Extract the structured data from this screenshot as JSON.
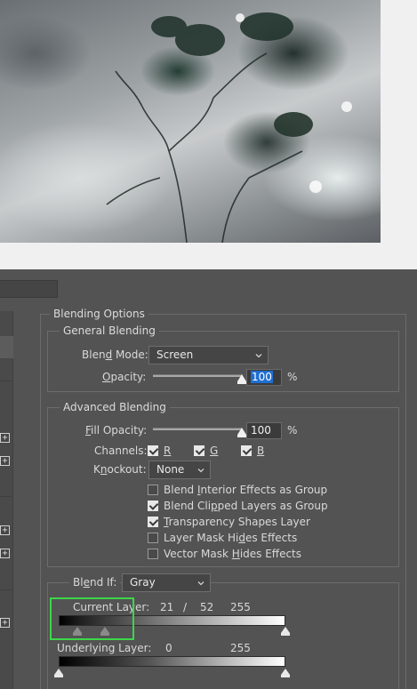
{
  "blending_options": {
    "title": "Blending Options",
    "general": {
      "title": "General Blending",
      "blend_mode_label_pre": "Blen",
      "blend_mode_label_u": "d",
      "blend_mode_label_post": " Mode:",
      "blend_mode_value": "Screen",
      "opacity_label_u": "O",
      "opacity_label_post": "pacity:",
      "opacity_value": "100",
      "opacity_percent": 100,
      "opacity_unit": "%"
    },
    "advanced": {
      "title": "Advanced Blending",
      "fill_opacity_label_u": "F",
      "fill_opacity_label_post": "ill Opacity:",
      "fill_opacity_value": "100",
      "fill_opacity_percent": 100,
      "fill_opacity_unit": "%",
      "channels_label": "Channels:",
      "channel_r": "R",
      "channel_g": "G",
      "channel_b": "B",
      "knockout_label_pre": "K",
      "knockout_label_u": "n",
      "knockout_label_post": "ockout:",
      "knockout_value": "None",
      "options": [
        {
          "pre": "Blend ",
          "u": "I",
          "post": "nterior Effects as Group",
          "checked": false
        },
        {
          "pre": "Blend Cli",
          "u": "p",
          "post": "ped Layers as Group",
          "checked": true
        },
        {
          "pre": "",
          "u": "T",
          "post": "ransparency Shapes Layer",
          "checked": true
        },
        {
          "pre": "Layer Mask Hi",
          "u": "d",
          "post": "es Effects",
          "checked": false
        },
        {
          "pre": "Vector Mask ",
          "u": "H",
          "post": "ides Effects",
          "checked": false
        }
      ]
    },
    "blend_if": {
      "label_pre": "Bl",
      "label_u": "e",
      "label_post": "nd If:",
      "value": "Gray",
      "current_layer": {
        "label": "Current Layer:",
        "low": "21",
        "separator": "/",
        "mid": "52",
        "high": "255"
      },
      "underlying_layer": {
        "label": "Underlying Layer:",
        "low": "0",
        "high": "255"
      }
    }
  },
  "left_panel": {
    "plus_symbol": "+"
  },
  "colors": {
    "panel_bg": "#535353",
    "selection_blue": "#1f6fd1",
    "highlight_green": "#3bd74a"
  }
}
